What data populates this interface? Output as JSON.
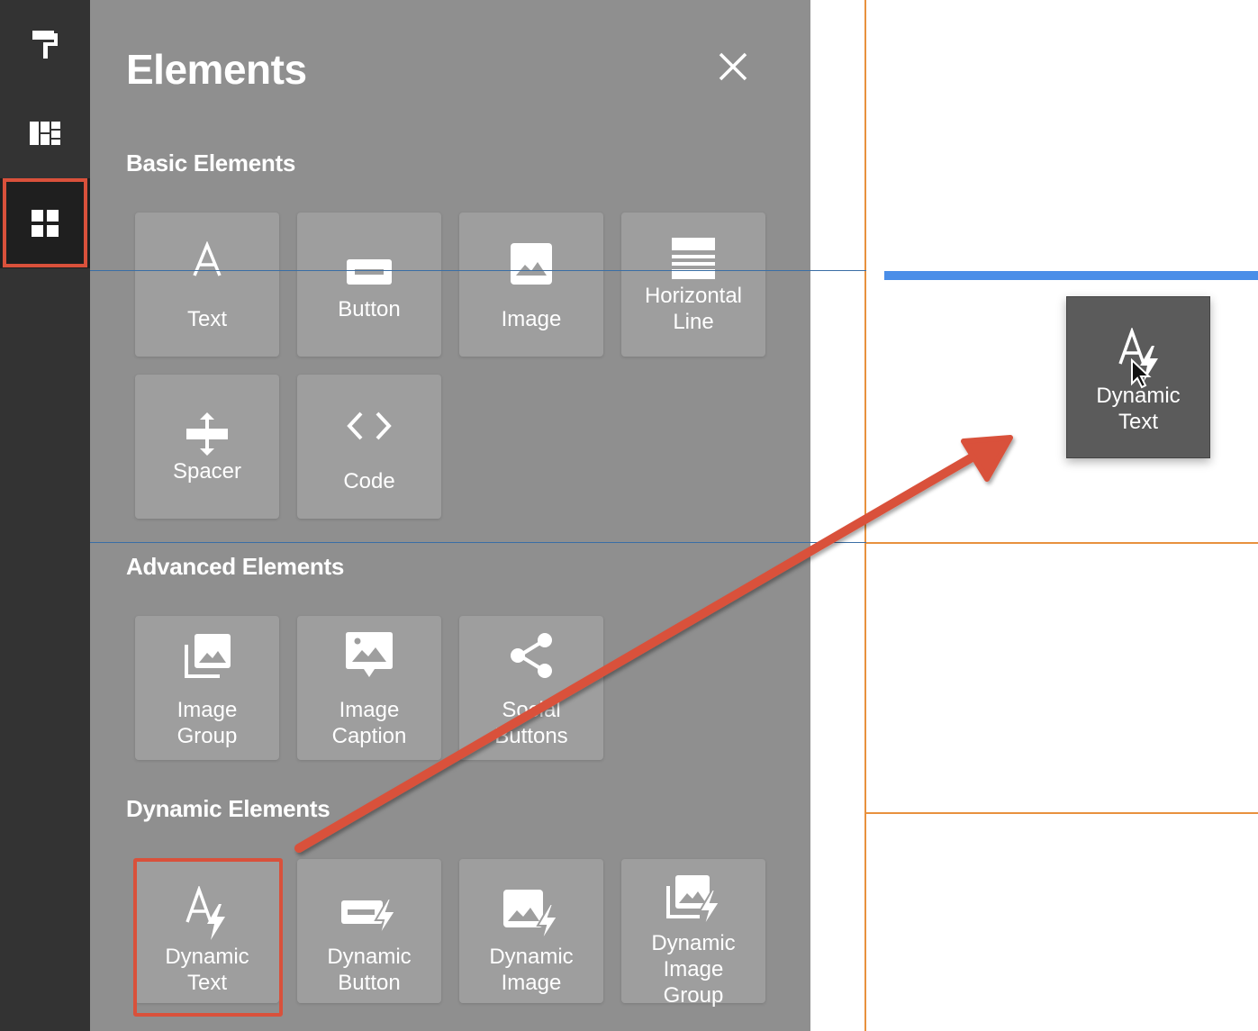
{
  "panel": {
    "title": "Elements"
  },
  "sections": [
    {
      "label": "Basic Elements"
    },
    {
      "label": "Advanced Elements"
    },
    {
      "label": "Dynamic Elements"
    }
  ],
  "basic": [
    {
      "label": "Text",
      "icon": "text-icon"
    },
    {
      "label": "Button",
      "icon": "button-icon"
    },
    {
      "label": "Image",
      "icon": "image-icon"
    },
    {
      "label": "Horizontal\nLine",
      "icon": "horizontal-line-icon"
    },
    {
      "label": "Spacer",
      "icon": "spacer-icon"
    },
    {
      "label": "Code",
      "icon": "code-icon"
    }
  ],
  "advanced": [
    {
      "label": "Image\nGroup",
      "icon": "image-group-icon"
    },
    {
      "label": "Image\nCaption",
      "icon": "image-caption-icon"
    },
    {
      "label": "Social\nButtons",
      "icon": "share-icon"
    }
  ],
  "dynamic": [
    {
      "label": "Dynamic\nText",
      "icon": "dynamic-text-icon"
    },
    {
      "label": "Dynamic\nButton",
      "icon": "dynamic-button-icon"
    },
    {
      "label": "Dynamic\nImage",
      "icon": "dynamic-image-icon"
    },
    {
      "label": "Dynamic\nImage\nGroup",
      "icon": "dynamic-image-group-icon"
    }
  ],
  "drag_ghost": {
    "label": "Dynamic\nText",
    "icon": "dynamic-text-icon"
  },
  "colors": {
    "rail": "#333333",
    "panel": "#8f8f8f",
    "tile": "#9e9e9e",
    "highlight": "#d9513b",
    "drop_indicator": "#4a8ee8",
    "canvas_grid": "#e8913e"
  }
}
